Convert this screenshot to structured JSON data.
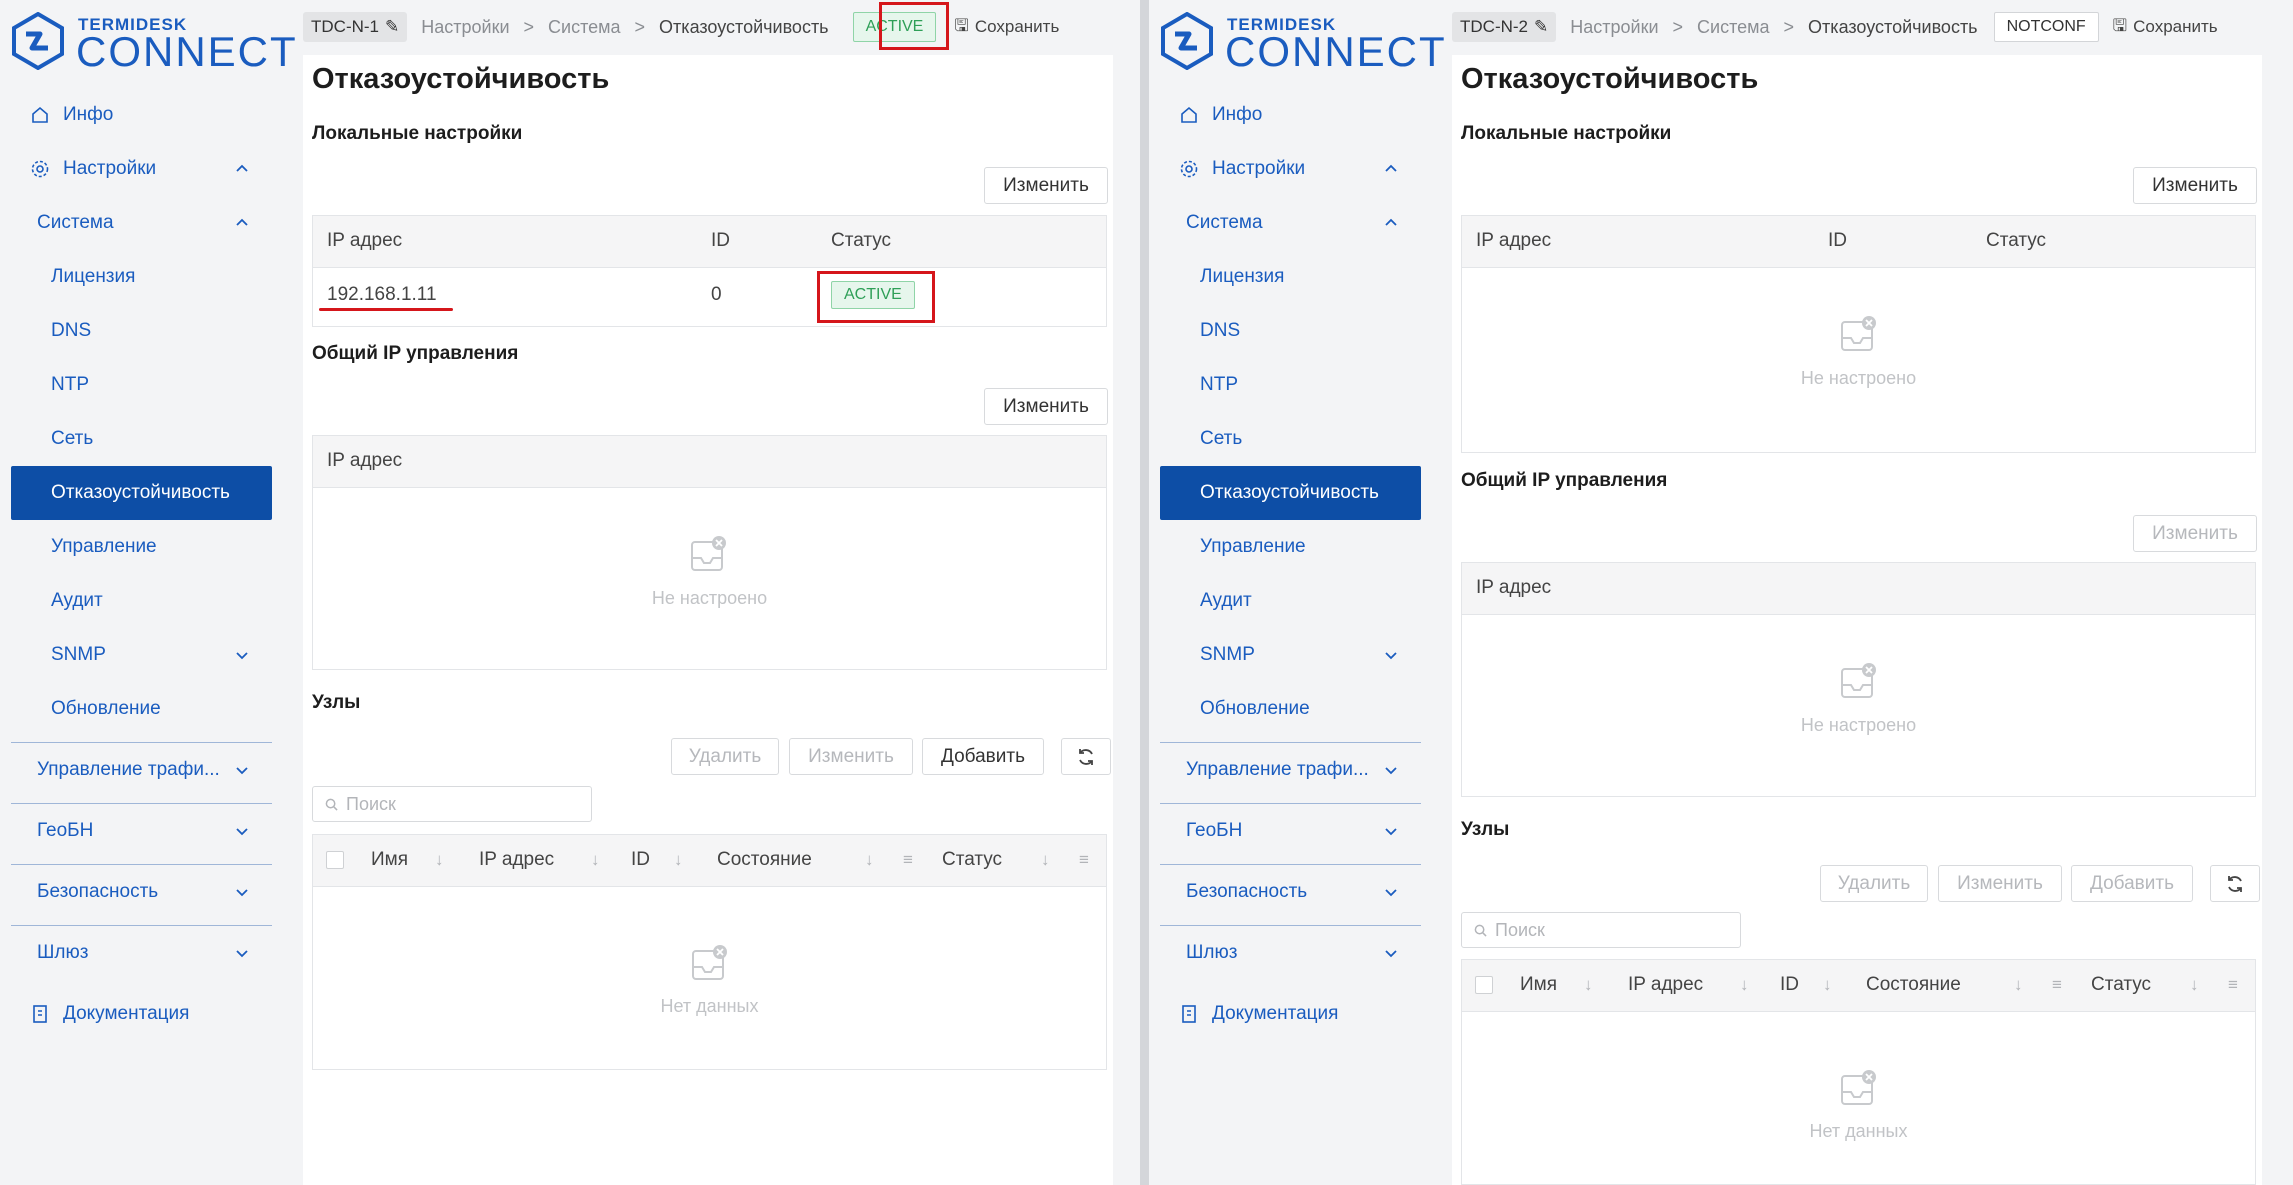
{
  "brand": {
    "top": "TERMIDESK",
    "bottom": "CONNECT",
    "color": "#1a5cbf"
  },
  "nav": {
    "info": "Инфо",
    "settings": "Настройки",
    "system": "Система",
    "license": "Лицензия",
    "dns": "DNS",
    "ntp": "NTP",
    "network": "Сеть",
    "failover": "Отказоустойчивость",
    "management": "Управление",
    "audit": "Аудит",
    "snmp": "SNMP",
    "update": "Обновление",
    "traffic": "Управление трафи...",
    "geobn": "ГеоБН",
    "security": "Безопасность",
    "gateway": "Шлюз",
    "docs": "Документация"
  },
  "breadcrumb": {
    "settings": "Настройки",
    "sep": ">",
    "system": "Система",
    "current": "Отказоустойчивость"
  },
  "save_label": "Сохранить",
  "page": {
    "title": "Отказоустойчивость",
    "local_settings": "Локальные настройки",
    "shared_ip": "Общий IP управления",
    "nodes": "Узлы",
    "edit": "Изменить",
    "delete": "Удалить",
    "add": "Добавить",
    "search_placeholder": "Поиск",
    "not_configured": "Не настроено",
    "no_data": "Нет данных",
    "col_ip": "IP адрес",
    "col_id": "ID",
    "col_status": "Статус",
    "col_name": "Имя",
    "col_state": "Состояние"
  },
  "left": {
    "node": "TDC-N-1",
    "status": "ACTIVE",
    "local_row": {
      "ip": "192.168.1.11",
      "id": "0",
      "status": "ACTIVE"
    }
  },
  "right": {
    "node": "TDC-N-2",
    "status": "NOTCONF"
  }
}
